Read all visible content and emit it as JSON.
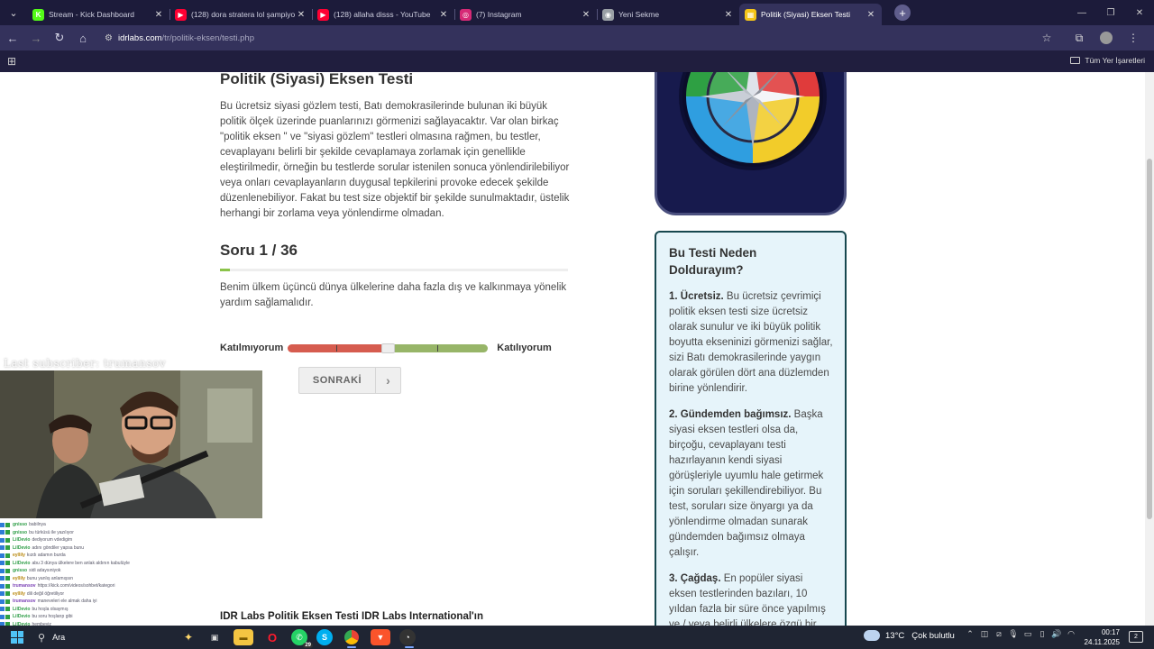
{
  "browser": {
    "tabs": [
      {
        "title": "Stream - Kick Dashboard",
        "favicon": "kick-icon",
        "color": "#53fc18",
        "glyph": "K"
      },
      {
        "title": "(128) dora stratera lol şampiyo",
        "favicon": "youtube-icon",
        "color": "#ff0033",
        "glyph": "▶"
      },
      {
        "title": "(128) allaha disss - YouTube",
        "favicon": "youtube-icon",
        "color": "#ff0033",
        "glyph": "▶"
      },
      {
        "title": "(7) Instagram",
        "favicon": "instagram-icon",
        "color": "#d62976",
        "glyph": "◎"
      },
      {
        "title": "Yeni Sekme",
        "favicon": "chrome-icon",
        "color": "#9aa0a6",
        "glyph": "◉"
      },
      {
        "title": "Politik (Siyasi) Eksen Testi",
        "favicon": "idrlabs-icon",
        "color": "#f5c518",
        "glyph": "▦"
      }
    ],
    "url_host": "idrlabs.com",
    "url_path": "/tr/politik-eksen/testi.php",
    "bookmarks_all": "Tüm Yer İşaretleri"
  },
  "article": {
    "title": "Politik (Siyasi) Eksen Testi",
    "intro": "Bu ücretsiz siyasi gözlem testi, Batı demokrasilerinde bulunan iki büyük politik ölçek üzerinde puanlarınızı görmenizi sağlayacaktır. Var olan birkaç \"politik eksen \" ve \"siyasi gözlem\" testleri olmasına rağmen, bu testler, cevaplayanı belirli bir şekilde cevaplamaya zorlamak için genellikle eleştirilmedir, örneğin bu testlerde sorular istenilen sonuca yönlendirilebiliyor veya onları cevaplayanların duygusal tepkilerini provoke edecek şekilde düzenlenebiliyor. Fakat bu test size objektif bir şekilde sunulmaktadır, üstelik herhangi bir zorlama veya yönlendirme olmadan.",
    "question_number": "Soru 1 / 36",
    "progress_fraction": 0.028,
    "question_text": "Benim ülkem üçüncü dünya ülkelerine daha fazla dış ve kalkınmaya yönelik yardım sağlamalıdır.",
    "scale_left": "Katılmıyorum",
    "scale_right": "Katılıyorum",
    "next_label": "SONRAKİ",
    "footer_title": "IDR Labs Politik Eksen Testi IDR Labs International'ın"
  },
  "why": {
    "title": "Bu Testi Neden Doldurayım?",
    "points": [
      {
        "head": "1. Ücretsiz.",
        "text": " Bu ücretsiz çevrimiçi politik eksen testi size ücretsiz olarak sunulur ve iki büyük politik boyutta ekseninizi görmenizi sağlar, sizi Batı demokrasilerinde yaygın olarak görülen dört ana düzlemden birine yönlendirir."
      },
      {
        "head": "2. Gündemden bağımsız.",
        "text": " Başka siyasi eksen testleri olsa da, birçoğu, cevaplayanı testi hazırlayanın kendi siyasi görüşleriyle uyumlu hale getirmek için soruları şekillendirebiliyor. Bu test, soruları size önyargı ya da yönlendirme olmadan sunarak gündemden bağımsız olmaya çalışır."
      },
      {
        "head": "3. Çağdaş.",
        "text": " En popüler siyasi eksen testlerinden bazıları, 10 yıldan fazla bir süre önce yapılmış ve / veya belirli ülkelere özgü bir"
      }
    ]
  },
  "stream": {
    "overlay": "Last subscriber: trumansov",
    "chat": [
      {
        "name": "gnisso",
        "color": "#2e9d47",
        "msg": "babilnya"
      },
      {
        "name": "gnisso",
        "color": "#2e9d47",
        "msg": "bu türküsü ile yazılıyor"
      },
      {
        "name": "LilDevio",
        "color": "#2e9d47",
        "msg": "dediyorum vdedigim"
      },
      {
        "name": "LilDevio",
        "color": "#2e9d47",
        "msg": "adını göndiler yapsa bunu"
      },
      {
        "name": "eyllily",
        "color": "#b8860b",
        "msg": "kızdı adamın burda"
      },
      {
        "name": "LilDevio",
        "color": "#2e9d47",
        "msg": "abu 3 dünya ülkelere ben anlak aldının kabulüyle"
      },
      {
        "name": "gnisso",
        "color": "#2e9d47",
        "msg": "sidi adaysıniyok"
      },
      {
        "name": "eyllily",
        "color": "#b8860b",
        "msg": "bunu yanlış anlamışsın"
      },
      {
        "name": "trumansov",
        "color": "#7a40b5",
        "msg": "https://kick.com/videos/sohbet/kategori"
      },
      {
        "name": "eyllily",
        "color": "#b8860b",
        "msg": "dili değil öğretiliyor"
      },
      {
        "name": "trumansov",
        "color": "#7a40b5",
        "msg": "maneveleri ele almak daha iyi"
      },
      {
        "name": "LilDevio",
        "color": "#2e9d47",
        "msg": "bu hoşla olsaymış"
      },
      {
        "name": "LilDevio",
        "color": "#2e9d47",
        "msg": "bu soru hoşlarıp gibi"
      },
      {
        "name": "LilDevio",
        "color": "#2e9d47",
        "msg": "hembeyiz"
      }
    ]
  },
  "taskbar": {
    "search": "Ara",
    "whatsapp_badge": "29",
    "temperature": "13°C",
    "weather_text": "Çok bulutlu",
    "time": "00:17",
    "date": "24.11.2025",
    "notifications": "2"
  }
}
